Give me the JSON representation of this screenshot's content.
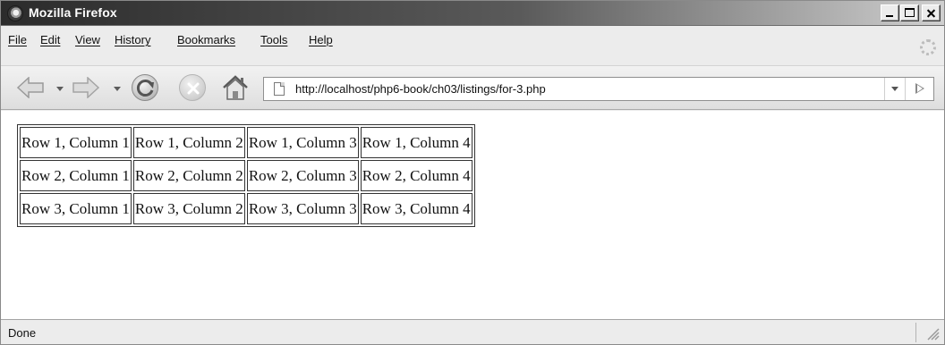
{
  "window": {
    "title": "Mozilla Firefox"
  },
  "menu": {
    "items": [
      {
        "label": "File"
      },
      {
        "label": "Edit"
      },
      {
        "label": "View"
      },
      {
        "label": "History"
      },
      {
        "label": "Bookmarks"
      },
      {
        "label": "Tools"
      },
      {
        "label": "Help"
      }
    ]
  },
  "toolbar": {
    "icons": [
      "back-arrow-icon",
      "forward-arrow-icon",
      "reload-icon",
      "stop-icon",
      "home-icon"
    ]
  },
  "address_bar": {
    "url": "http://localhost/php6-book/ch03/listings/for-3.php",
    "icon": "page-icon"
  },
  "page": {
    "table": {
      "rows": [
        [
          "Row 1, Column 1",
          "Row 1, Column 2",
          "Row 1, Column 3",
          "Row 1, Column 4"
        ],
        [
          "Row 2, Column 1",
          "Row 2, Column 2",
          "Row 2, Column 3",
          "Row 2, Column 4"
        ],
        [
          "Row 3, Column 1",
          "Row 3, Column 2",
          "Row 3, Column 3",
          "Row 3, Column 4"
        ]
      ]
    }
  },
  "status": {
    "text": "Done"
  }
}
